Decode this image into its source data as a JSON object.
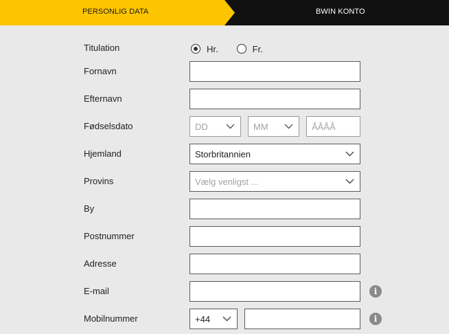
{
  "steps": {
    "active": "PERSONLIG DATA",
    "next": "BWIN KONTO"
  },
  "form": {
    "titulation": {
      "label": "Titulation",
      "options": [
        "Hr.",
        "Fr."
      ],
      "selected": "Hr."
    },
    "first_name": {
      "label": "Fornavn",
      "value": ""
    },
    "last_name": {
      "label": "Efternavn",
      "value": ""
    },
    "birthdate": {
      "label": "Fødselsdato",
      "day_placeholder": "DD",
      "month_placeholder": "MM",
      "year_placeholder": "ÅÅÅÅ"
    },
    "country": {
      "label": "Hjemland",
      "value": "Storbritannien"
    },
    "province": {
      "label": "Provins",
      "placeholder": "Vælg venligst ..."
    },
    "city": {
      "label": "By",
      "value": ""
    },
    "postal_code": {
      "label": "Postnummer",
      "value": ""
    },
    "address": {
      "label": "Adresse",
      "value": ""
    },
    "email": {
      "label": "E-mail",
      "value": "",
      "info_icon": "info-icon"
    },
    "mobile": {
      "label": "Mobilnummer",
      "prefix": "+44",
      "value": "",
      "info_icon": "info-icon"
    }
  },
  "colors": {
    "accent": "#fdc500",
    "header_dark": "#111111",
    "background": "#e9e9e9",
    "border": "#5a5a5a",
    "info_icon": "#8a8a8a"
  }
}
